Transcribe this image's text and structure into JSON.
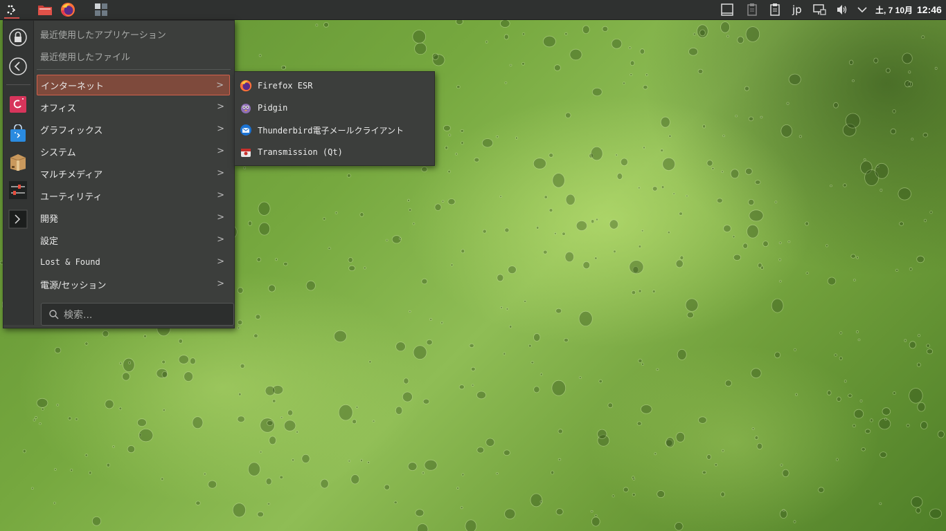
{
  "panel": {
    "menu_icon": "debian-menu-icon",
    "launchers": [
      {
        "name": "file-manager-launcher",
        "icon": "folder-icon"
      },
      {
        "name": "firefox-launcher",
        "icon": "firefox-icon"
      },
      {
        "name": "desktop-switcher",
        "icon": "workspace-grid-icon"
      }
    ],
    "tray": {
      "keyboard_layout": "jp",
      "date": "土, 7 10月",
      "time": "12:46"
    }
  },
  "menu": {
    "sidebar": [
      {
        "name": "lock-button",
        "icon": "lock-icon"
      },
      {
        "name": "back-button",
        "icon": "back-arrow-icon"
      },
      {
        "name": "debian-app-button",
        "icon": "debian-swirl-icon"
      },
      {
        "name": "software-store-button",
        "icon": "store-bag-icon"
      },
      {
        "name": "package-manager-button",
        "icon": "package-box-icon"
      },
      {
        "name": "system-settings-button",
        "icon": "sliders-icon"
      },
      {
        "name": "terminal-button",
        "icon": "terminal-icon"
      }
    ],
    "recent_apps": "最近使用したアプリケーション",
    "recent_files": "最近使用したファイル",
    "categories": [
      {
        "label": "インターネット",
        "active": true
      },
      {
        "label": "オフィス"
      },
      {
        "label": "グラフィックス"
      },
      {
        "label": "システム"
      },
      {
        "label": "マルチメディア"
      },
      {
        "label": "ユーティリティ"
      },
      {
        "label": "開発"
      },
      {
        "label": "設定"
      },
      {
        "label": "Lost & Found"
      },
      {
        "label": "電源/セッション"
      }
    ],
    "arrow": ">",
    "search_placeholder": "検索..."
  },
  "submenu": {
    "items": [
      {
        "label": "Firefox ESR",
        "icon": "firefox-icon"
      },
      {
        "label": "Pidgin",
        "icon": "pidgin-icon"
      },
      {
        "label": "Thunderbird電子メールクライアント",
        "icon": "thunderbird-icon"
      },
      {
        "label": "Transmission (Qt)",
        "icon": "transmission-icon"
      }
    ]
  },
  "colors": {
    "accent": "#d3614c",
    "active_bg": "#7e4a3c",
    "menu_bg": "#3c3e3c",
    "panel_bg": "#2f3130"
  }
}
